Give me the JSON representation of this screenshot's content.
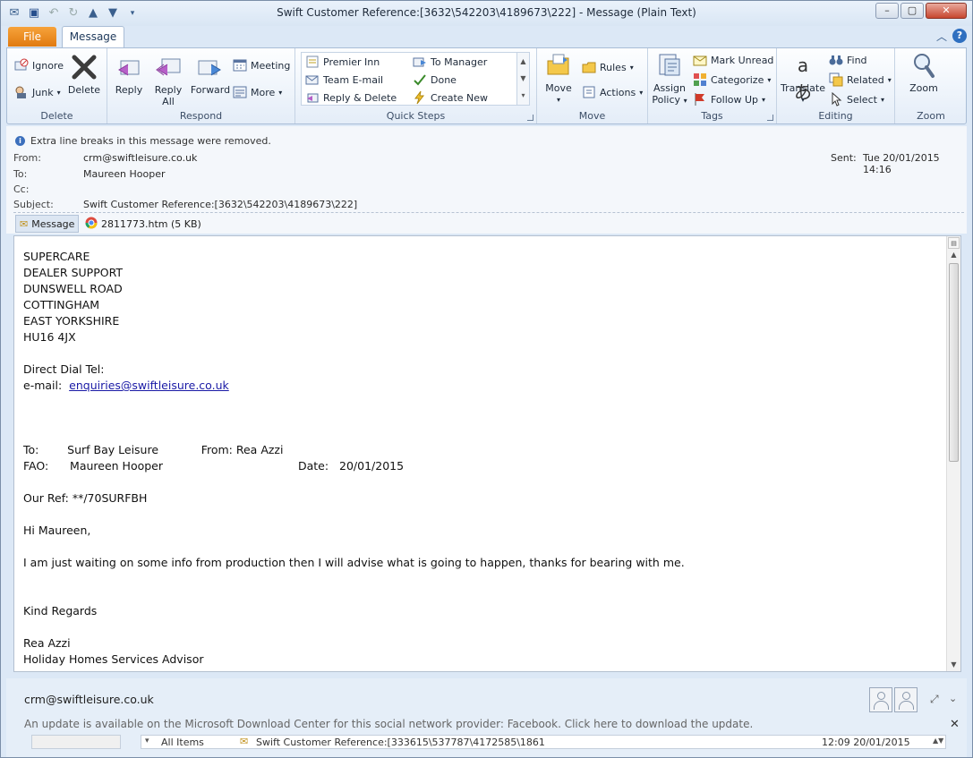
{
  "window": {
    "title": "Swift Customer Reference:[3632\\542203\\4189673\\222]  -  Message (Plain Text)"
  },
  "tabs": {
    "file": "File",
    "message": "Message"
  },
  "ribbon": {
    "delete_group": {
      "ignore": "Ignore",
      "junk": "Junk",
      "delete": "Delete",
      "label": "Delete"
    },
    "respond_group": {
      "reply": "Reply",
      "reply_all_1": "Reply",
      "reply_all_2": "All",
      "forward": "Forward",
      "meeting": "Meeting",
      "more": "More",
      "label": "Respond"
    },
    "quick_steps": {
      "premier_inn": "Premier Inn",
      "team_email": "Team E-mail",
      "reply_delete": "Reply & Delete",
      "to_manager": "To Manager",
      "done": "Done",
      "create_new": "Create New",
      "label": "Quick Steps"
    },
    "move_group": {
      "move": "Move",
      "rules": "Rules",
      "actions": "Actions",
      "label": "Move"
    },
    "tags_group": {
      "assign_1": "Assign",
      "assign_2": "Policy",
      "mark_unread": "Mark Unread",
      "categorize": "Categorize",
      "follow_up": "Follow Up",
      "label": "Tags"
    },
    "editing_group": {
      "translate": "Translate",
      "find": "Find",
      "related": "Related",
      "select": "Select",
      "label": "Editing"
    },
    "zoom_group": {
      "zoom": "Zoom",
      "label": "Zoom"
    }
  },
  "header": {
    "info": "Extra line breaks in this message were removed.",
    "from_label": "From:",
    "from": "crm@swiftleisure.co.uk",
    "to_label": "To:",
    "to": "Maureen Hooper",
    "cc_label": "Cc:",
    "subject_label": "Subject:",
    "subject": "Swift Customer Reference:[3632\\542203\\4189673\\222]",
    "sent_label": "Sent:",
    "sent": "Tue 20/01/2015 14:16"
  },
  "attachments": {
    "message_tab": "Message",
    "file": "2811773.htm (5 KB)"
  },
  "body": {
    "address": "SUPERCARE\nDEALER SUPPORT\nDUNSWELL ROAD\nCOTTINGHAM\nEAST YORKSHIRE\nHU16 4JX",
    "direct_dial": "Direct Dial Tel:",
    "email_label": "e-mail:  ",
    "email_link": "enquiries@swiftleisure.co.uk",
    "to_line": "To:        Surf Bay Leisure            From: Rea Azzi",
    "fao_line": "FAO:      Maureen Hooper                                      Date:   20/01/2015",
    "ref": "Our Ref: **/70SURFBH",
    "greeting": "Hi Maureen,",
    "message": "I am just waiting on some info from production then I will advise what is going to happen, thanks for bearing with me.",
    "regards": "Kind Regards",
    "signature": "Rea Azzi\nHoliday Homes Services Advisor"
  },
  "social": {
    "name": "crm@swiftleisure.co.uk",
    "notice": "An update is available on the Microsoft Download Center for this social network provider: Facebook. Click here to download the update.",
    "all_items": "All Items",
    "item_subject": "Swift Customer Reference:[333615\\537787\\4172585\\1861",
    "item_date": "12:09  20/01/2015"
  }
}
